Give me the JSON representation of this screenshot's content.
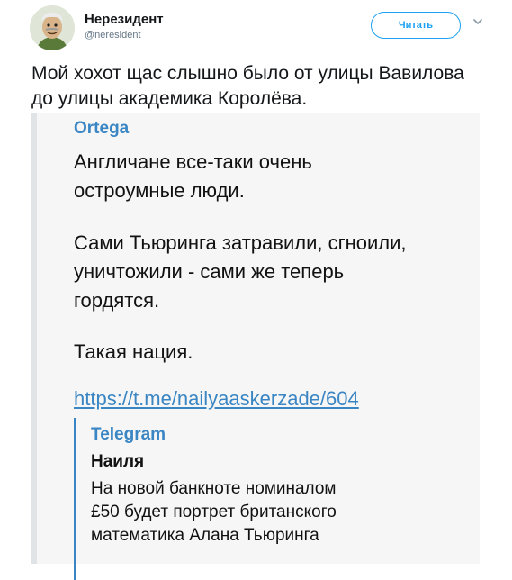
{
  "author": {
    "name": "Нерезидент",
    "handle": "@neresident",
    "avatar_icon": "avatar-cartoon-icon"
  },
  "follow_button": {
    "label": "Читать"
  },
  "menu_icon": "chevron-down-icon",
  "tweet": {
    "text": "Мой хохот щас слышно было от улицы Вавилова до улицы академика Королёва."
  },
  "quote": {
    "source": "Ortega",
    "paragraphs": [
      "Англичане все-таки очень\nостроумные люди.",
      "Сами Тьюринга затравили, сгноили,\nуничтожили - сами же теперь\nгордятся.",
      "Такая нация."
    ],
    "link": "https://t.me/nailyaaskerzade/604",
    "preview": {
      "source": "Telegram",
      "title": "Наиля",
      "text": "На новой банкноте номиналом\n£50 будет портрет британского\nматематика Алана Тьюринга"
    }
  },
  "colors": {
    "accent": "#1da1f2",
    "link": "#3a85c3",
    "quote_bg": "#f5f6f5"
  }
}
